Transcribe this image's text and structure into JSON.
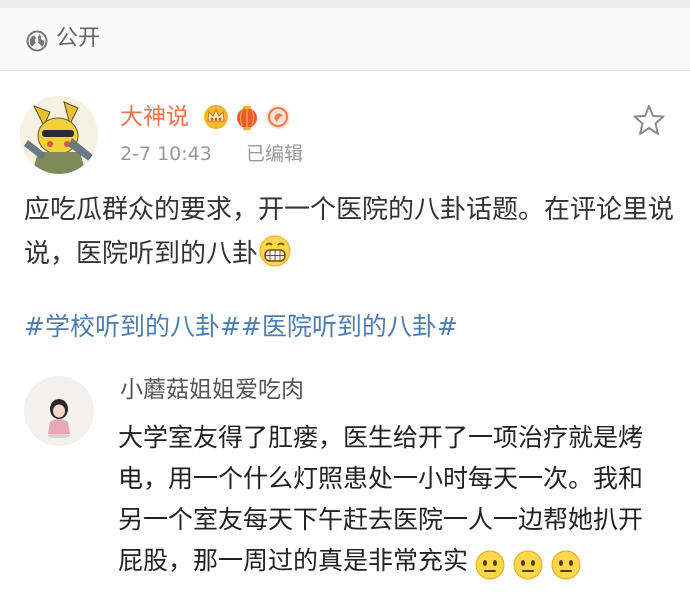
{
  "visibility": {
    "label": "公开",
    "icon": "globe-icon"
  },
  "post": {
    "author": "大神说",
    "badges": [
      "crown-badge-icon",
      "lantern-badge-icon",
      "gift-badge-icon"
    ],
    "time": "2-7 10:43",
    "edited": "已编辑",
    "text": "应吃瓜群众的要求，开一个医院的八卦话题。在评论里说说，医院听到的八卦",
    "text_emoji": "grin-emoji-icon",
    "topics": "#学校听到的八卦##医院听到的八卦#"
  },
  "comment": {
    "user": "小蘑菇姐姐爱吃肉",
    "text": "大学室友得了肛瘘，医生给开了一项治疗就是烤电，用一个什么灯照患处一小时每天一次。我和另一个室友每天下午赶去医院一人一边帮她扒开屁股，那一周过的真是非常充实",
    "emojis": [
      "awkward-emoji-icon",
      "awkward-emoji-icon",
      "awkward-emoji-icon"
    ]
  },
  "colors": {
    "author": "#eb7350",
    "topic_link": "#507daf",
    "meta_text": "#999999",
    "body_text": "#333333"
  }
}
